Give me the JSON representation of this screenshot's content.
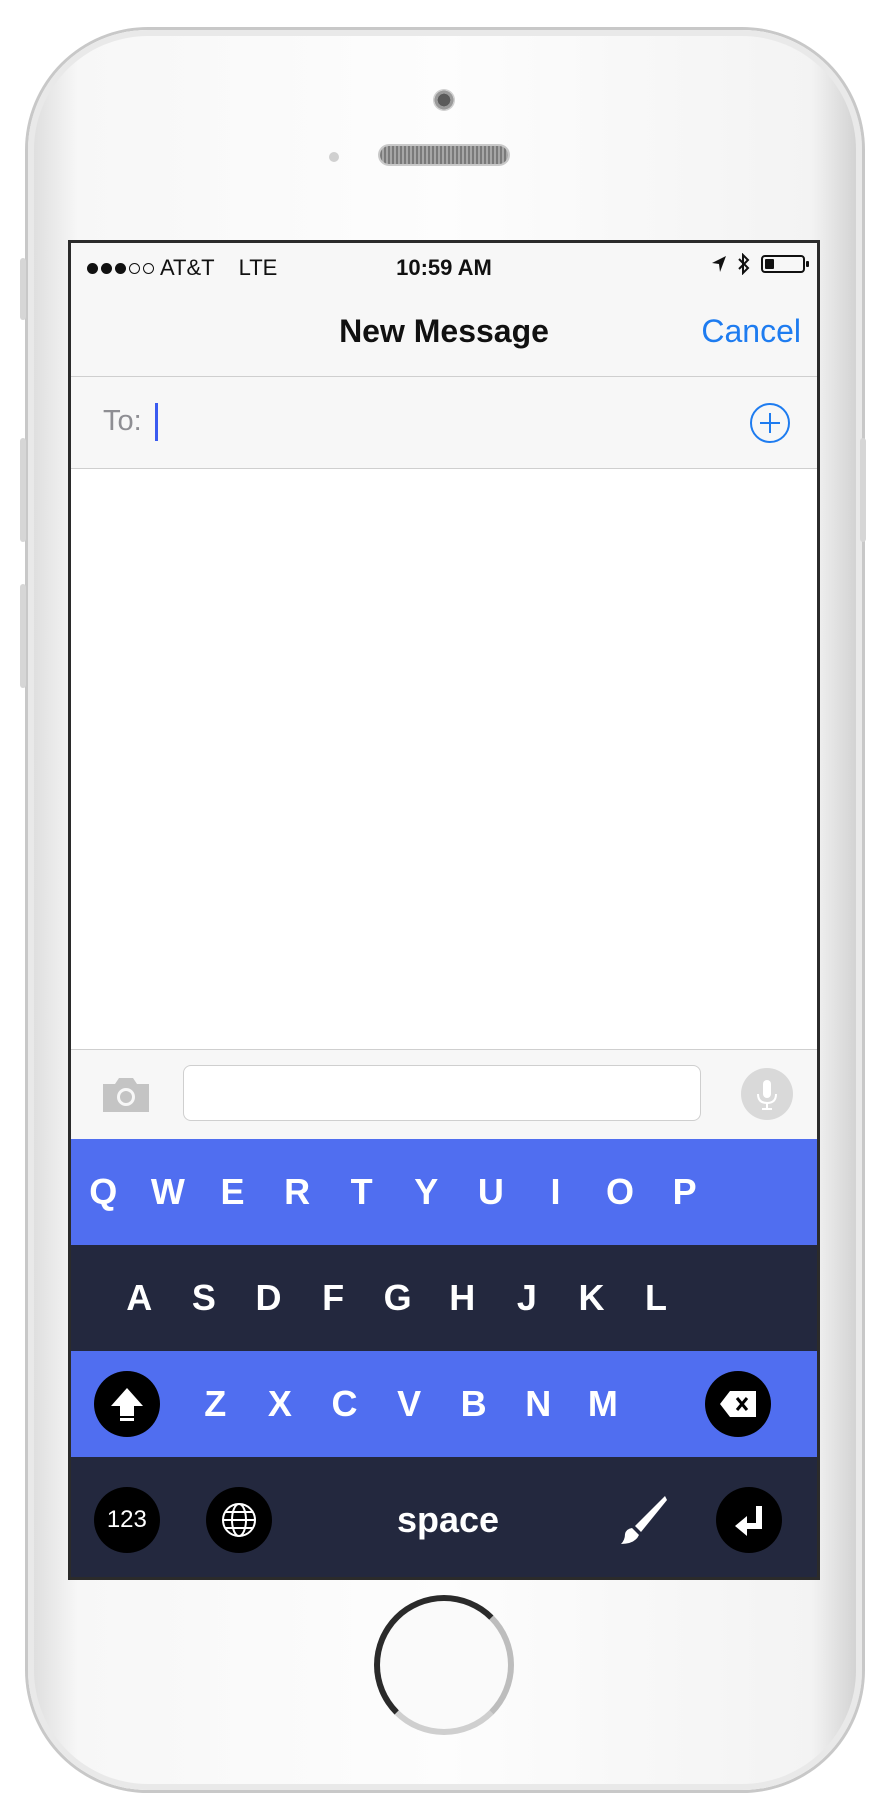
{
  "status": {
    "carrier": "AT&T",
    "network": "LTE",
    "time": "10:59 AM",
    "signal_bars": 3,
    "signal_total": 5,
    "battery_level": 0.25
  },
  "nav": {
    "title": "New Message",
    "cancel_label": "Cancel"
  },
  "recipient": {
    "label": "To:",
    "value": ""
  },
  "composer": {
    "message_value": "",
    "camera_icon": "camera-icon",
    "mic_icon": "microphone-icon"
  },
  "keyboard": {
    "row1": [
      "Q",
      "W",
      "E",
      "R",
      "T",
      "Y",
      "U",
      "I",
      "O",
      "P"
    ],
    "row2": [
      "A",
      "S",
      "D",
      "F",
      "G",
      "H",
      "J",
      "K",
      "L"
    ],
    "row3": [
      "Z",
      "X",
      "C",
      "V",
      "B",
      "N",
      "M"
    ],
    "numbers_label": "123",
    "space_label": "space",
    "shift_icon": "shift-icon",
    "backspace_icon": "backspace-icon",
    "globe_icon": "globe-icon",
    "theme_icon": "brush-icon",
    "return_icon": "return-icon"
  },
  "colors": {
    "accent": "#1e7cf0",
    "keyboard_blue": "#506ef0",
    "keyboard_dark": "#23283e"
  }
}
